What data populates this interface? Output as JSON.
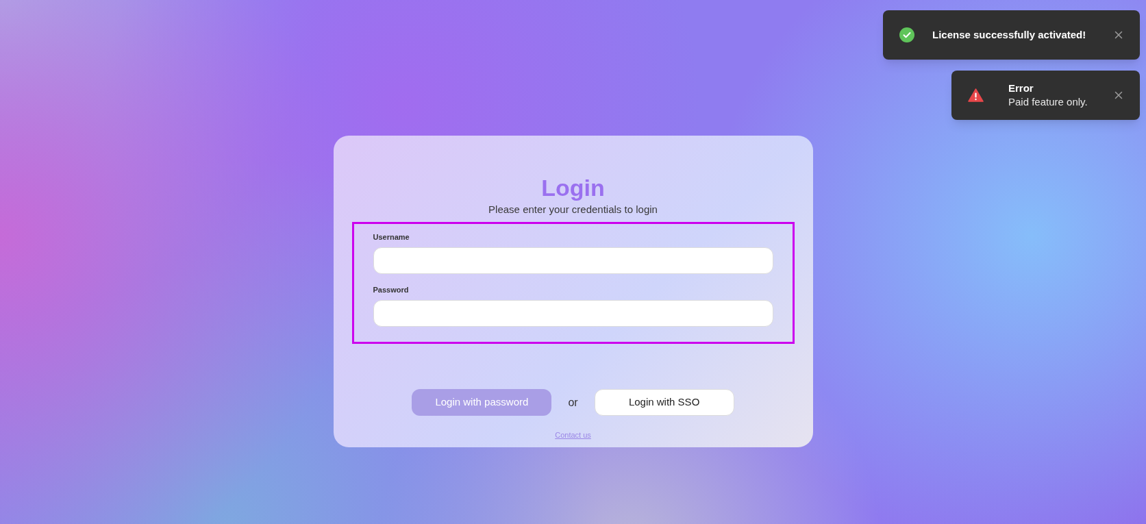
{
  "toasts": [
    {
      "kind": "success",
      "title": "License successfully activated!"
    },
    {
      "kind": "error",
      "title": "Error",
      "message": "Paid feature only."
    }
  ],
  "login": {
    "title": "Login",
    "subtitle": "Please enter your credentials to login",
    "fields_highlighted": true,
    "fields": [
      {
        "label": "Username"
      },
      {
        "label": "Password"
      }
    ],
    "buttons": [
      {
        "label": "Login with password",
        "kind": "primary"
      },
      {
        "label": "Login with SSO",
        "kind": "secondary"
      }
    ],
    "separator": "or",
    "link": "Contact us"
  }
}
